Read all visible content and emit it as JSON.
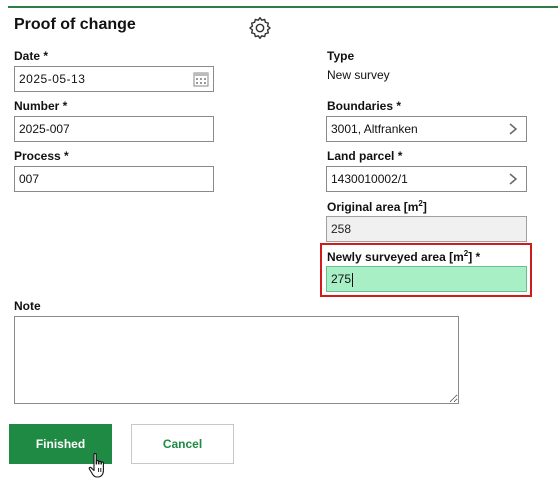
{
  "header": {
    "title": "Proof of change",
    "settings_icon": "gear-icon"
  },
  "form": {
    "date": {
      "label": "Date *",
      "value": "2025-05-13",
      "icon": "calendar-icon"
    },
    "number": {
      "label": "Number *",
      "value": "2025-007"
    },
    "process": {
      "label": "Process *",
      "value": "007"
    },
    "type": {
      "label": "Type",
      "value": "New survey"
    },
    "boundaries": {
      "label": "Boundaries *",
      "value": "3001, Altfranken",
      "icon": "chevron-right-icon"
    },
    "land_parcel": {
      "label": "Land parcel *",
      "value": "1430010002/1",
      "icon": "chevron-right-icon"
    },
    "original_area": {
      "label_text": "Original area [m",
      "label_sup": "2",
      "label_end": "]",
      "value": "258"
    },
    "newly_surveyed_area": {
      "label_text": "Newly surveyed area [m",
      "label_sup": "2",
      "label_end": "] *",
      "value": "275"
    },
    "note": {
      "label": "Note",
      "value": ""
    }
  },
  "actions": {
    "finished_label": "Finished",
    "cancel_label": "Cancel"
  },
  "colors": {
    "accent": "#1e8a43",
    "highlight_border": "#d11a1a",
    "active_field": "#a8efc6"
  }
}
